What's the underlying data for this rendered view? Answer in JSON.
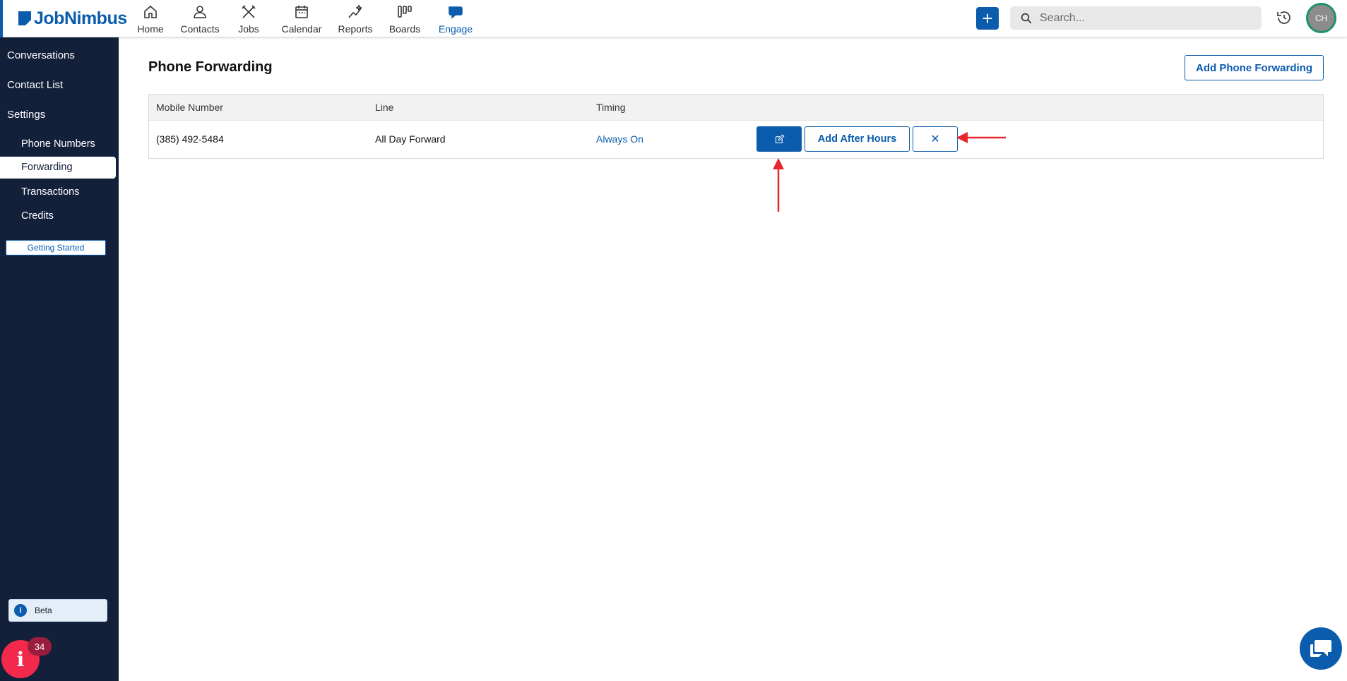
{
  "app": {
    "name": "JobNimbus"
  },
  "nav": {
    "items": [
      {
        "label": "Home",
        "icon": "home-icon"
      },
      {
        "label": "Contacts",
        "icon": "person-icon"
      },
      {
        "label": "Jobs",
        "icon": "tools-icon"
      },
      {
        "label": "Calendar",
        "icon": "calendar-icon"
      },
      {
        "label": "Reports",
        "icon": "sparkle-chart-icon"
      },
      {
        "label": "Boards",
        "icon": "boards-icon"
      },
      {
        "label": "Engage",
        "icon": "chat-bubble-icon",
        "active": true
      }
    ]
  },
  "header": {
    "search_placeholder": "Search...",
    "avatar_initials": "CH"
  },
  "sidebar": {
    "items": [
      "Conversations",
      "Contact List",
      "Settings"
    ],
    "settings_sub": [
      "Phone Numbers",
      "Forwarding",
      "Transactions",
      "Credits"
    ],
    "active": "Forwarding",
    "getting_started": "Getting Started",
    "beta_label": "Beta",
    "notification_count": "34"
  },
  "main": {
    "title": "Phone Forwarding",
    "add_button": "Add Phone Forwarding",
    "table": {
      "columns": [
        "Mobile Number",
        "Line",
        "Timing"
      ],
      "rows": [
        {
          "mobile": "(385) 492-5484",
          "line": "All Day Forward",
          "timing": "Always On",
          "after_hours_button": "Add After Hours",
          "delete_glyph": "✕"
        }
      ]
    }
  },
  "colors": {
    "brand": "#0b5cad",
    "sidebar": "#12203a",
    "annotation": "#e8262b"
  }
}
